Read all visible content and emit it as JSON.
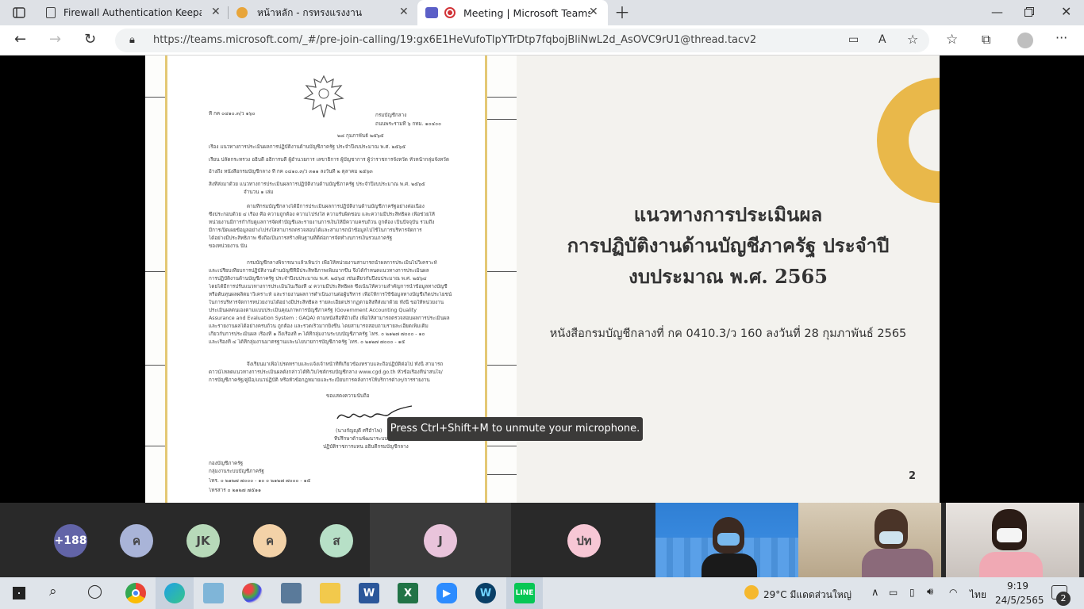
{
  "browser": {
    "tabs": [
      {
        "title": "Firewall Authentication Keepalive",
        "active": false
      },
      {
        "title": "หน้าหลัก - กรทรงแรงงาน",
        "active": false
      },
      {
        "title": "Meeting | Microsoft Teams",
        "active": true
      }
    ],
    "url": "https://teams.microsoft.com/_#/pre-join-calling/19:gx6E1HeVufoTlpYTrDtp7fqbojBliNwL2d_AsOVC9rU1@thread.tacv2",
    "new_tab_icon": "plus-icon"
  },
  "slide": {
    "title_lines": [
      "แนวทางการประเมินผล",
      "การปฏิบัติงานด้านบัญชีภาครัฐ ประจำปี",
      "งบประมาณ พ.ศ. 2565"
    ],
    "subtitle": "หนังสือกรมบัญชีกลางที่ กค 0410.3/ว 160 ลงวันที่ 28 กุมภาพันธ์ 2565",
    "page_number": "2",
    "accent_color": "#e9b84a"
  },
  "document": {
    "ref_no": "ที่ กค ๐๔๑๐.๓/ว ๑๖๐",
    "office": "กรมบัญชีกลาง",
    "address": "ถนนพระรามที่ ๖ กทม. ๑๐๔๐๐",
    "date": "๒๘ กุมภาพันธ์ ๒๕๖๕",
    "subject": "เรื่อง  แนวทางการประเมินผลการปฏิบัติงานด้านบัญชีภาครัฐ ประจำปีงบประมาณ พ.ศ. ๒๕๖๕",
    "to": "เรียน  ปลัดกระทรวง อธิบดี อธิการบดี ผู้อำนวยการ เลขาธิการ ผู้บัญชาการ ผู้ว่าราชการจังหวัด หัวหน้ากลุ่มจังหวัด",
    "reference": "อ้างถึง  หนังสือกรมบัญชีกลาง ที่ กค ๐๔๑๐.๓/ว ๓๑๑ ลงวันที่ ๒ ตุลาคม ๒๕๖๓",
    "attachment": "สิ่งที่ส่งมาด้วย  แนวทางการประเมินผลการปฏิบัติงานด้านบัญชีภาครัฐ ประจำปีงบประมาณ พ.ศ. ๒๕๖๕",
    "attachment_count": "จำนวน ๑ เล่ม",
    "para1": [
      "ตามที่กรมบัญชีกลางได้มีการประเมินผลการปฏิบัติงานด้านบัญชีภาครัฐอย่างต่อเนื่อง",
      "ซึ่งประกอบด้วย ๔ เรื่อง คือ ความถูกต้อง ความโปร่งใส ความรับผิดชอบ และความมีประสิทธิผล เพื่อช่วยให้",
      "หน่วยงานมีการกำกับดูแลการจัดทำบัญชีและรายงานการเงินให้มีความครบถ้วน ถูกต้อง เป็นปัจจุบัน รวมถึง",
      "มีการเปิดเผยข้อมูลอย่างโปร่งใสสามารถตรวจสอบได้และสามารถนำข้อมูลไปใช้ในการบริหารจัดการ",
      "ได้อย่างมีประสิทธิภาพ ซึ่งถือเป็นการสร้างพื้นฐานที่ดีต่อการจัดทำงบการเงินรวมภาครัฐ",
      "ของหน่วยงาน นั้น"
    ],
    "para2": [
      "กรมบัญชีกลางพิจารณาแล้วเห็นว่า เพื่อให้หน่วยงานสามารถนำผลการประเมินไปวิเคราะห์",
      "และเปรียบเทียบการปฏิบัติงานด้านบัญชีที่มีประสิทธิภาพเพิ่มมากขึ้น จึงได้กำหนดแนวทางการประเมินผล",
      "การปฏิบัติงานด้านบัญชีภาครัฐ ประจำปีงบประมาณ พ.ศ. ๒๕๖๕ เช่นเดียวกับปีงบประมาณ พ.ศ. ๒๕๖๔",
      "โดยได้มีการปรับแนวทางการประเมินในเรื่องที่ ๔ ความมีประสิทธิผล ซึ่งเน้นให้ความสำคัญการนำข้อมูลทางบัญชี",
      "หรือต้นทุนผลผลิตมาวิเคราะห์ และรายงานผลการดำเนินงานต่อผู้บริหาร เพื่อให้การใช้ข้อมูลทางบัญชีเกิดประโยชน์",
      "ในการบริหารจัดการหน่วยงานได้อย่างมีประสิทธิผล รายละเอียดปรากฏตามสิ่งที่ส่งมาด้วย ทั้งนี้ ขอให้หน่วยงาน",
      "ประเมินผลตนเองตามแบบประเมินคุณภาพการบัญชีภาครัฐ (Government Accounting Quality",
      "Assurance and Evaluation System : GAQA) ตามหนังสือที่อ้างถึง เพื่อให้สามารถตรวจสอบผลการประเมินผล",
      "และรายงานผลได้อย่างครบถ้วน ถูกต้อง และรวดเร็วมากยิ่งขึ้น โดยสามารถสอบถามรายละเอียดเพิ่มเติม",
      "เกี่ยวกับการประเมินผล เรื่องที่ ๑ ถึงเรื่องที่ ๓ ได้ที่กลุ่มงานระบบบัญชีภาครัฐ โทร. ๐ ๒๑๒๗ ๗๐๐๐ - ๑๐",
      "และเรื่องที่ ๔ ได้ที่กลุ่มงานมาตรฐานและนโยบายการบัญชีภาครัฐ โทร. ๐ ๒๑๒๗ ๗๐๐๐ - ๑๕"
    ],
    "para3": [
      "จึงเรียนมาเพื่อโปรดทราบและแจ้งเจ้าหน้าที่ที่เกี่ยวข้องทราบและถือปฏิบัติต่อไป ทั้งนี้ สามารถ",
      "ดาวน์โหลดแนวทางการประเมินผลดังกล่าวได้ที่เว็บไซต์กรมบัญชีกลาง www.cgd.go.th หัวข้อเรื่องที่น่าสนใจ/",
      "การบัญชีภาครัฐ/คู่มือ/แนวปฏิบัติ หรือหัวข้อกฎหมายและระเบียบการคลังการให้บริการต่างๆ/การรายงาน"
    ],
    "closing": "ขอแสดงความนับถือ",
    "signer_name": "(นางกัญญุดี  ศรีอำไพ)",
    "signer_title1": "ที่ปรึกษาด้านพัฒนาระบบบัญชี",
    "signer_title2": "ปฏิบัติราชการแทน อธิบดีกรมบัญชีกลาง",
    "dept": "กองบัญชีภาครัฐ",
    "group": "กลุ่มงานระบบบัญชีภาครัฐ",
    "tel": "โทร. ๐ ๒๑๒๗ ๗๐๐๐ - ๑๐ ๐ ๒๑๒๗ ๗๐๐๐ - ๑๕",
    "fax": "โทรสาร ๐ ๒๑๒๗ ๗๕๑๑"
  },
  "toast": "Press Ctrl+Shift+M to unmute your microphone.",
  "participants": {
    "overflow": "+188",
    "avatars": [
      {
        "initials": "ค",
        "color": "#a9b4d8"
      },
      {
        "initials": "JK",
        "color": "#b7d9b9"
      },
      {
        "initials": "ค",
        "color": "#f3d2a8"
      },
      {
        "initials": "ส",
        "color": "#b7e0c7"
      },
      {
        "initials": "J",
        "color": "#e9c4db"
      },
      {
        "initials": "ปท",
        "color": "#f7c7d5"
      }
    ],
    "overflow_color": "#6264a7"
  },
  "taskbar": {
    "weather": "29°C  มีแดดส่วนใหญ่",
    "language": "ไทย",
    "time": "9:19",
    "date": "24/5/2565",
    "notifications": "2"
  }
}
